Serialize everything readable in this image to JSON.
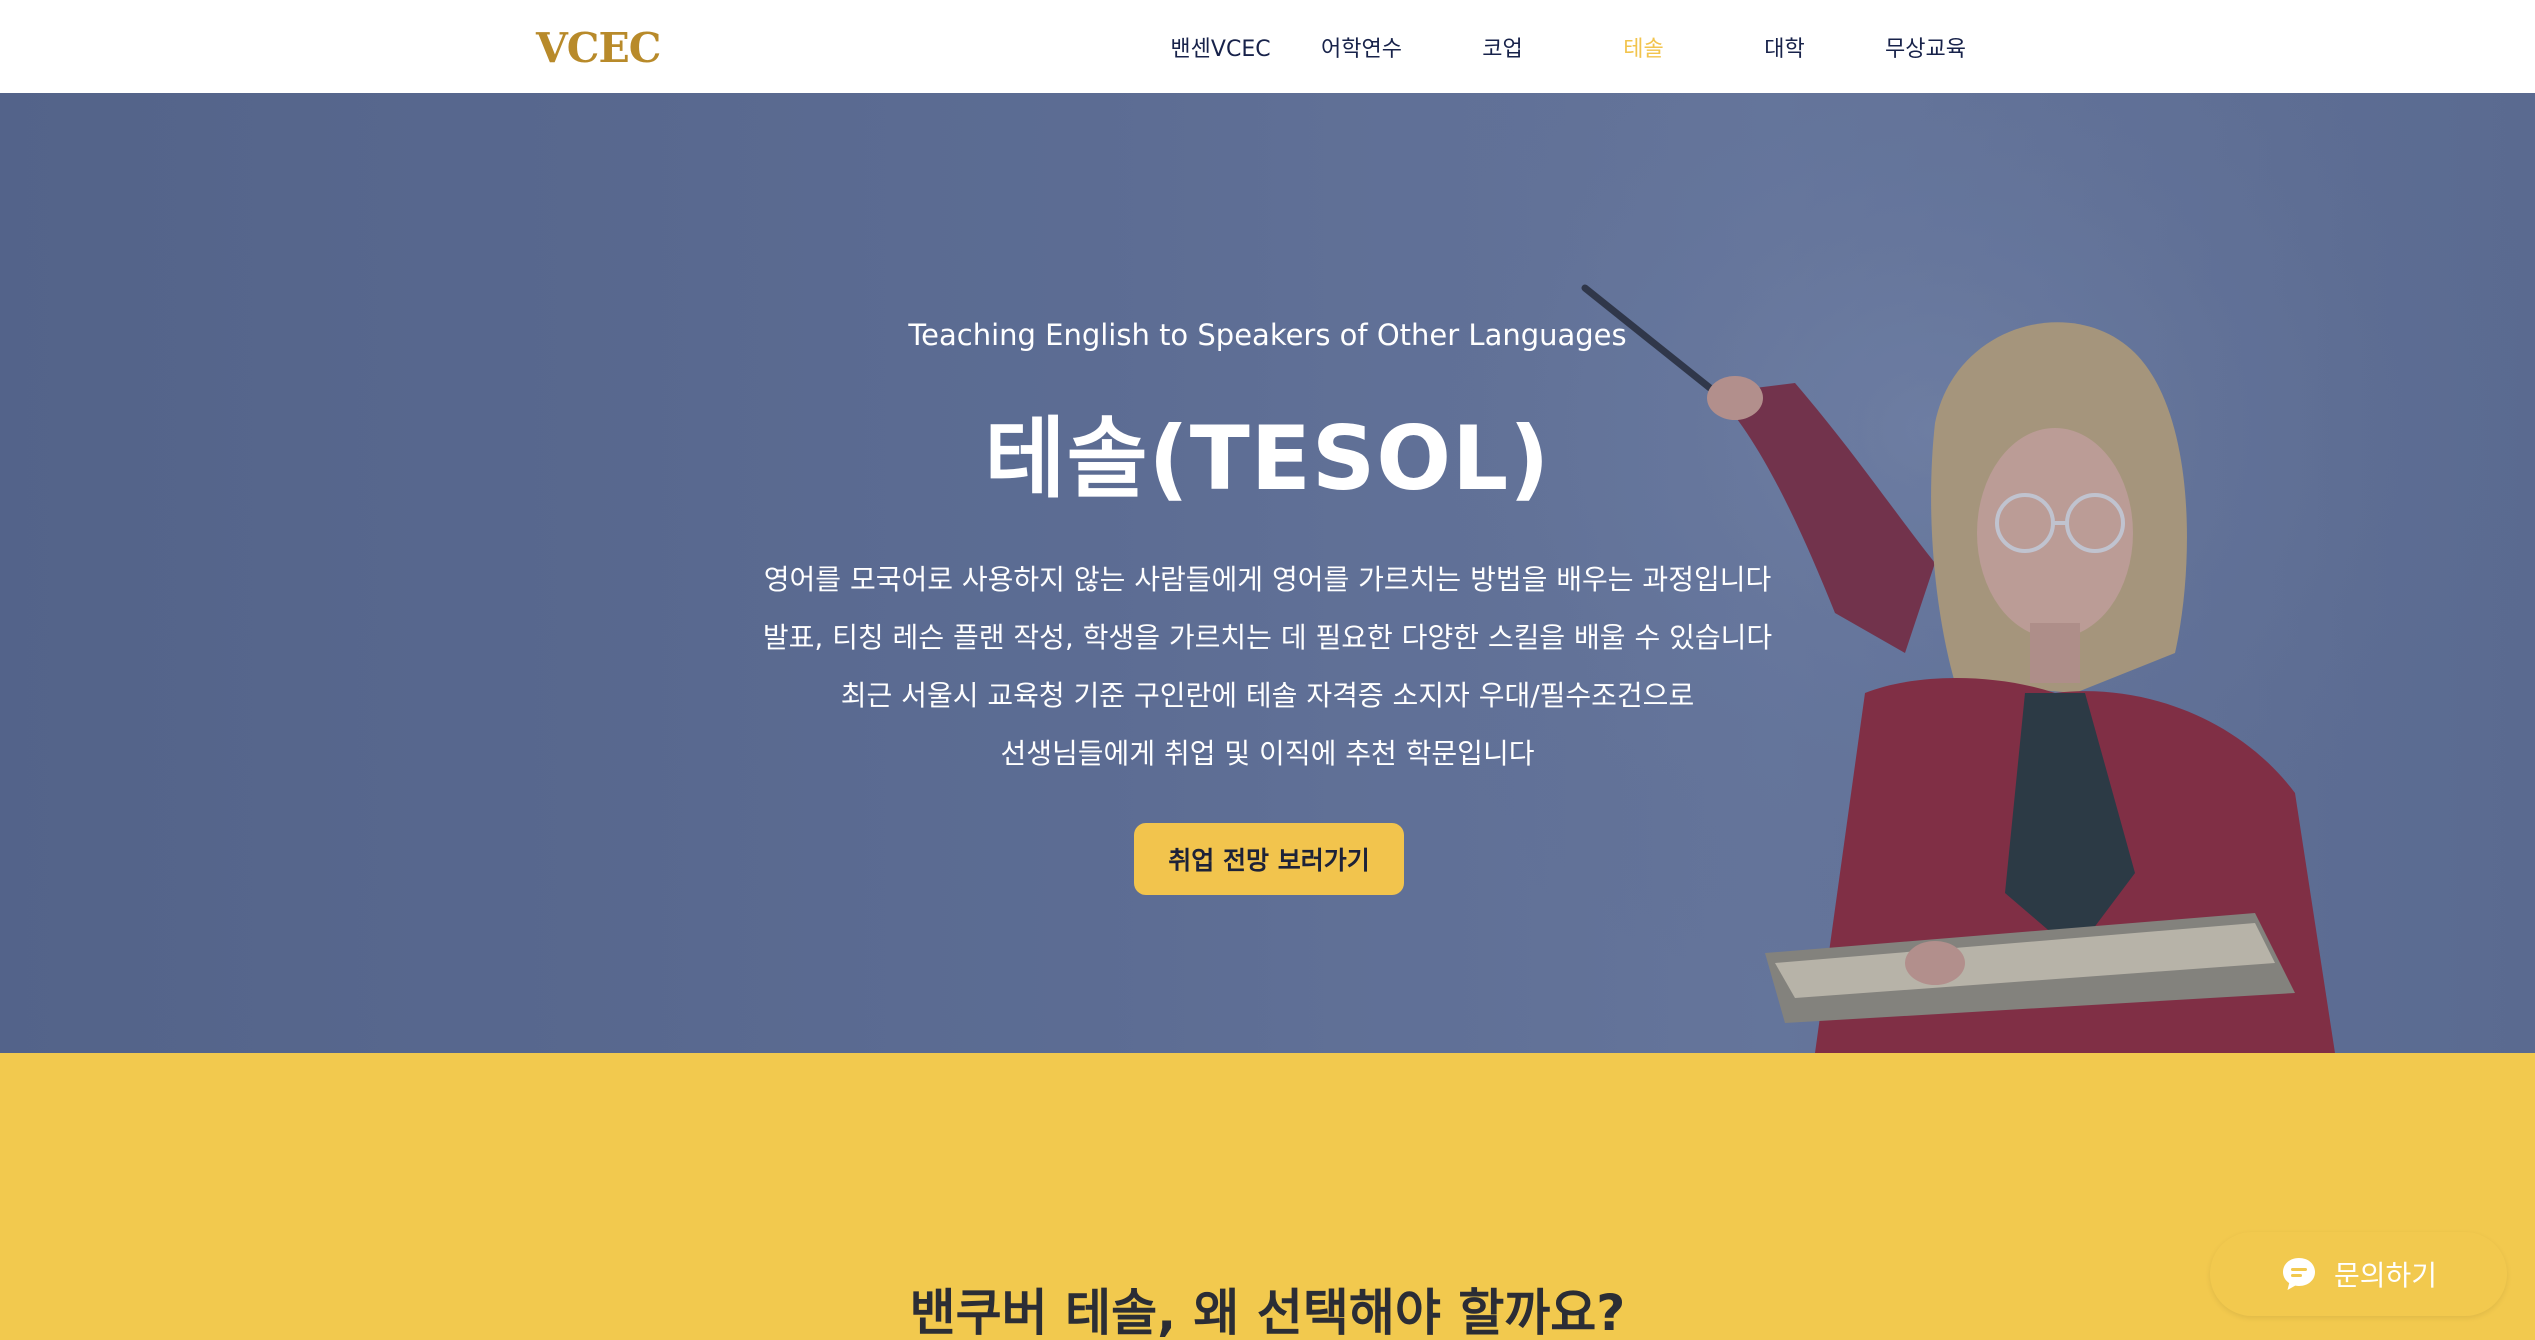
{
  "header": {
    "logo": "VCEC",
    "nav": [
      {
        "label": "밴센VCEC",
        "active": false
      },
      {
        "label": "어학연수",
        "active": false
      },
      {
        "label": "코업",
        "active": false
      },
      {
        "label": "테솔",
        "active": true
      },
      {
        "label": "대학",
        "active": false
      },
      {
        "label": "무상교육",
        "active": false
      }
    ]
  },
  "hero": {
    "subtitle": "Teaching English to Speakers of Other Languages",
    "title": "테솔(TESOL)",
    "description": [
      "영어를 모국어로 사용하지 않는 사람들에게 영어를 가르치는 방법을 배우는 과정입니다",
      "발표, 티칭 레슨 플랜 작성, 학생을 가르치는 데 필요한 다양한 스킬을 배울 수 있습니다",
      "최근 서울시 교육청 기준 구인란에 테솔 자격증 소지자 우대/필수조건으로",
      "선생님들에게 취업 및 이직에 추천 학문입니다"
    ],
    "cta_label": "취업 전망 보러가기"
  },
  "section": {
    "title": "밴쿠버 테솔, 왜 선택해야 할까요?"
  },
  "chat": {
    "label": "문의하기",
    "icon": "chat-bubble-icon"
  },
  "colors": {
    "accent": "#f2c44d",
    "nav_text": "#17224a",
    "logo": "#b88a2a",
    "section_bg": "#f2c94e"
  }
}
